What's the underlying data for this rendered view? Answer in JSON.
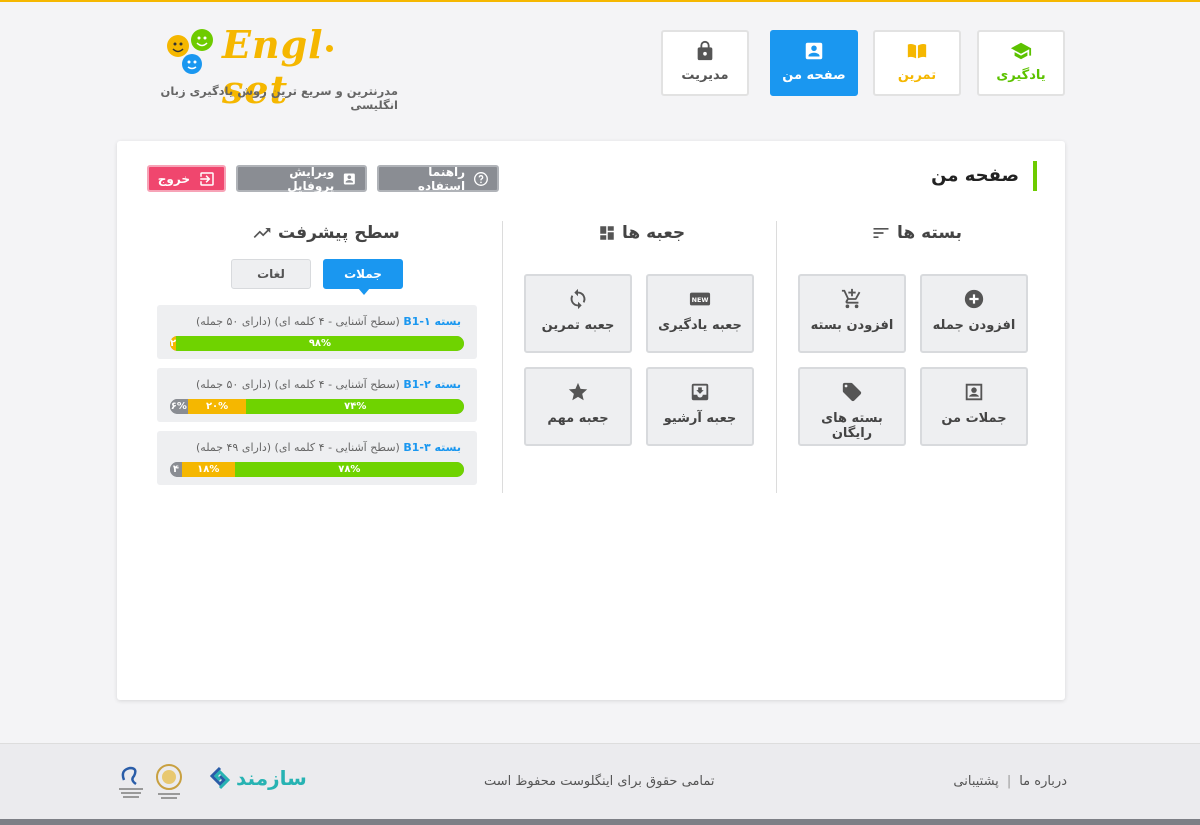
{
  "header": {
    "brand": "Engl·set",
    "tagline": "مدرنترین و سریع ترین روش یادگیری زبان انگلیسی",
    "nav": [
      {
        "key": "learn",
        "label": "یادگیری",
        "icon": "graduation-cap-icon",
        "color": "#5cc200"
      },
      {
        "key": "practice",
        "label": "تمرین",
        "icon": "book-icon",
        "color": "#f5b700"
      },
      {
        "key": "mypage",
        "label": "صفحه من",
        "icon": "account-box-icon",
        "active": true,
        "color": "#1a97f0"
      },
      {
        "key": "admin",
        "label": "مدیریت",
        "icon": "lock-icon",
        "color": "#555555"
      }
    ]
  },
  "main": {
    "title": "صفحه من",
    "buttons": {
      "guide": "راهنما استفاده",
      "profile": "ویرایش پروفایل",
      "exit": "خروج"
    },
    "packages": {
      "title": "بسته ها",
      "tiles": [
        {
          "label": "افزودن جمله",
          "icon": "add-circle-icon"
        },
        {
          "label": "افزودن بسته",
          "icon": "add-cart-icon"
        },
        {
          "label": "جملات من",
          "icon": "account-box-icon"
        },
        {
          "label": "بسته های رایگان",
          "icon": "tag-icon"
        }
      ]
    },
    "boxes": {
      "title": "جعبه ها",
      "tiles": [
        {
          "label": "جعبه یادگیری",
          "icon": "new-badge-icon",
          "badge": "NEW"
        },
        {
          "label": "جعبه تمرین",
          "icon": "refresh-icon"
        },
        {
          "label": "جعبه آرشیو",
          "icon": "archive-icon"
        },
        {
          "label": "جعبه مهم",
          "icon": "star-icon"
        }
      ]
    },
    "progress": {
      "title": "سطح پیشرفت",
      "tabs": {
        "sentences": "جملات",
        "words": "لغات"
      },
      "items": [
        {
          "name": "بسته B1-۱",
          "desc": "(سطح آشنایی - ۴ کلمه ای) (دارای ۵۰ جمله)",
          "green": 98,
          "green_label": "۹۸%",
          "orange": 2,
          "orange_label": "۲",
          "gray": 0,
          "gray_label": ""
        },
        {
          "name": "بسته B1-۲",
          "desc": "(سطح آشنایی - ۴ کلمه ای) (دارای ۵۰ جمله)",
          "green": 74,
          "green_label": "۷۴%",
          "orange": 20,
          "orange_label": "۲۰%",
          "gray": 6,
          "gray_label": "۶%"
        },
        {
          "name": "بسته B1-۳",
          "desc": "(سطح آشنایی - ۴ کلمه ای) (دارای ۴۹ جمله)",
          "green": 78,
          "green_label": "۷۸%",
          "orange": 18,
          "orange_label": "۱۸%",
          "gray": 4,
          "gray_label": "۴"
        }
      ]
    }
  },
  "footer": {
    "about": "درباره ما",
    "support": "پشتیبانی",
    "copyright": "تمامی حقوق برای اینگلوست محفوظ است",
    "sazmand": "سازمند"
  }
}
